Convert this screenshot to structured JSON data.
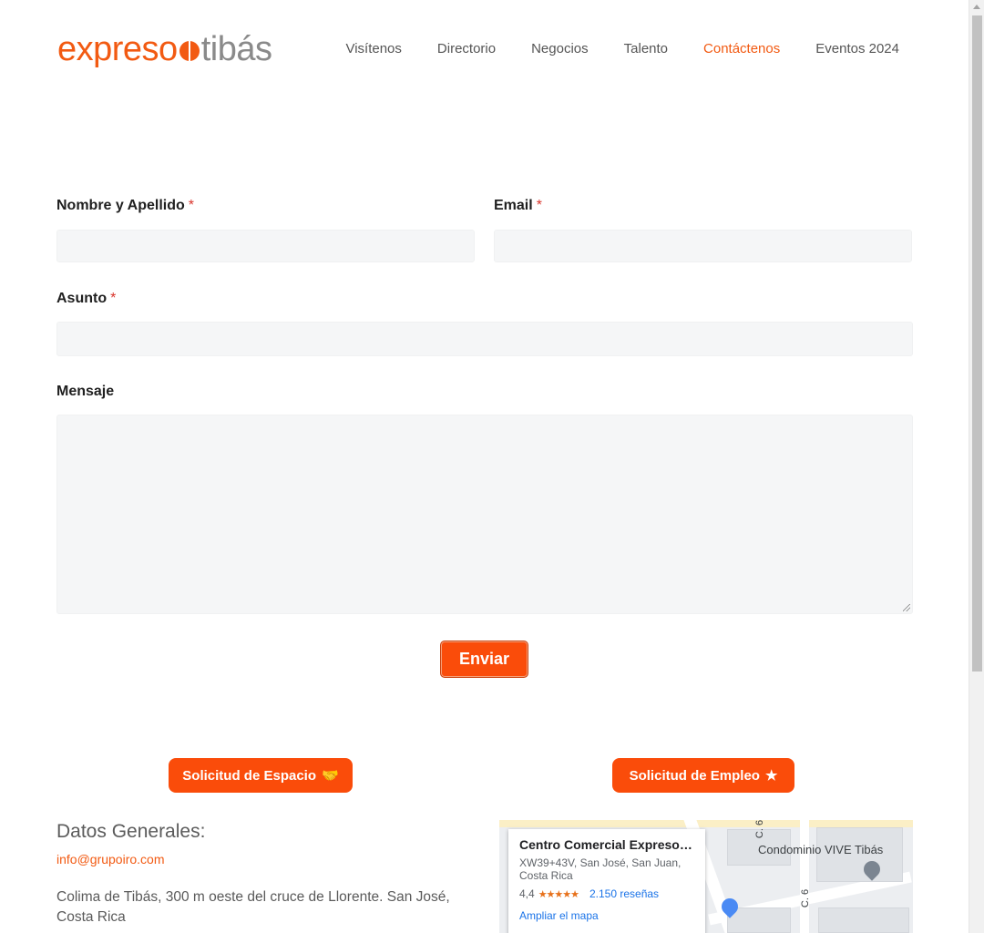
{
  "brand": {
    "part1": "expreso",
    "part2": "tibás"
  },
  "nav": [
    "Visítenos",
    "Directorio",
    "Negocios",
    "Talento",
    "Contáctenos",
    "Eventos 2024"
  ],
  "form": {
    "name_label": "Nombre y Apellido",
    "email_label": "Email",
    "subject_label": "Asunto",
    "message_label": "Mensaje",
    "required_mark": "*",
    "name_value": "",
    "email_value": "",
    "subject_value": "",
    "message_value": "",
    "submit_label": "Enviar"
  },
  "actions": {
    "space_request": "Solicitud de Espacio",
    "job_request": "Solicitud de Empleo"
  },
  "general": {
    "heading": "Datos Generales:",
    "email": "info@grupoiro.com",
    "address": "Colima de Tibás, 300 m oeste del cruce de Llorente. San José, Costa Rica"
  },
  "map": {
    "place_name": "Centro Comercial Expreso Tib…",
    "address": "XW39+43V, San José, San Juan, Costa Rica",
    "rating": "4,4",
    "stars": "★★★★★",
    "reviews": "2.150 reseñas",
    "enlarge": "Ampliar el mapa",
    "label_condo": "Condominio VIVE Tibás",
    "label_c6": "C. 6",
    "label_c6b": "C. 6"
  },
  "colors": {
    "accent": "#fa4c0a",
    "link": "#f25a12",
    "field_bg": "#f5f6f7"
  }
}
